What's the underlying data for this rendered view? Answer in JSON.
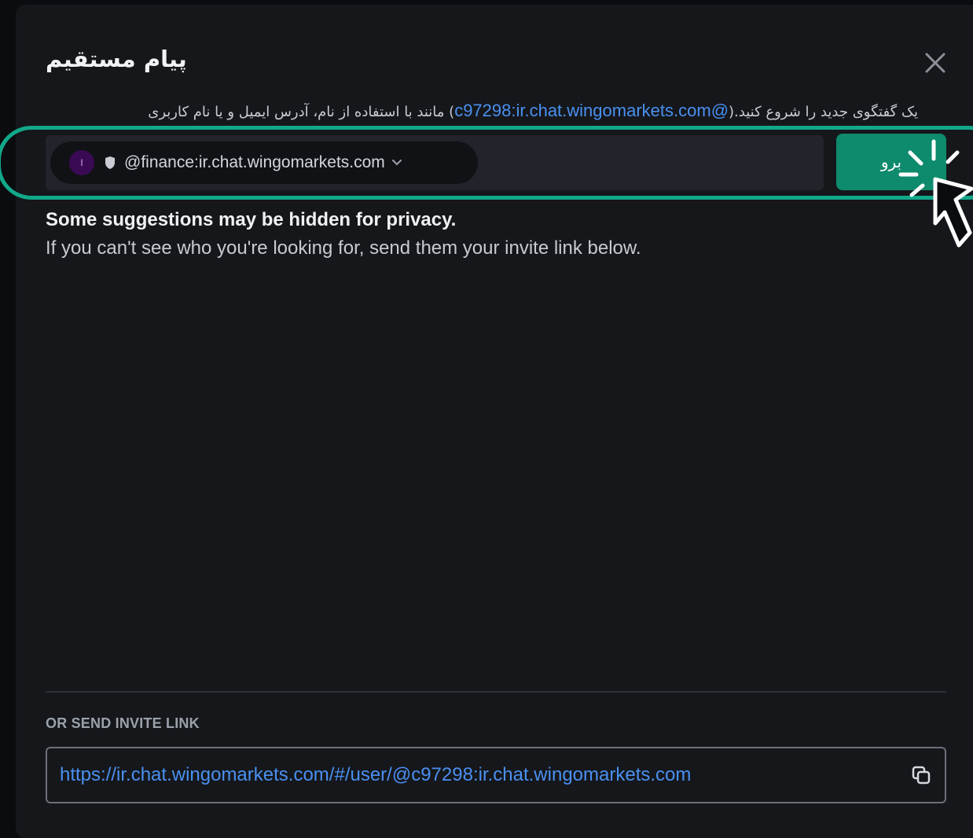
{
  "dialog": {
    "title": "پیام مستقیم",
    "subtitle_text": "یک گفتگوی جدید را شروع کنید.(",
    "subtitle_link": "@c97298:ir.chat.wingomarkets.com",
    "subtitle_text_after": ") مانند با استفاده از نام، آدرس ایمیل و یا نام کاربری",
    "close_icon": "close-icon"
  },
  "search": {
    "pill_avatar": "ا",
    "pill_text": "@finance:ir.chat.wingomarkets.com",
    "go_label": "برو"
  },
  "suggestions": {
    "hidden_notice": "Some suggestions may be hidden for privacy.",
    "hint": "If you can't see who you're looking for, send them your invite link below."
  },
  "invite": {
    "section_label": "OR SEND INVITE LINK",
    "link": "https://ir.chat.wingomarkets.com/#/user/@c97298:ir.chat.wingomarkets.com",
    "copy_icon": "copy-icon"
  },
  "colors": {
    "accent": "#0e8a6c",
    "highlight": "#12a88a",
    "link": "#4a90f0",
    "background": "#15171b"
  }
}
